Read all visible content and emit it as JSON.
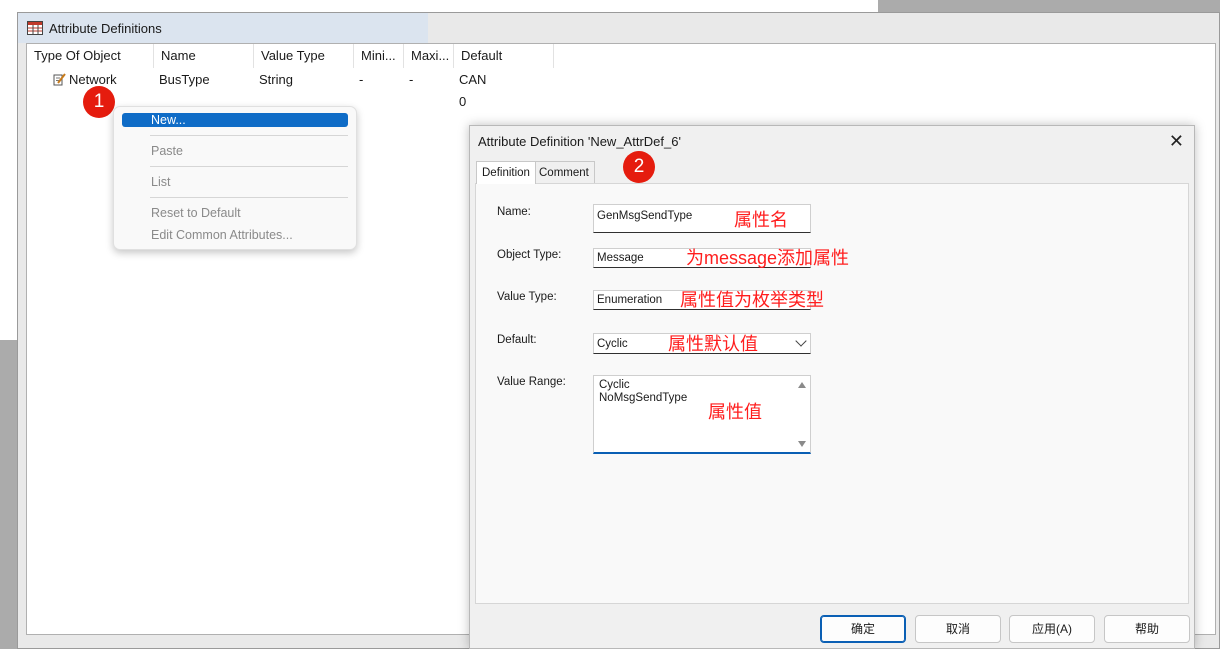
{
  "main_window": {
    "title": "Attribute Definitions",
    "columns": [
      "Type Of Object",
      "Name",
      "Value Type",
      "Mini...",
      "Maxi...",
      "Default"
    ],
    "rows": [
      {
        "type_of_object": "Network",
        "name": "BusType",
        "value_type": "String",
        "minimum": "-",
        "maximum": "-",
        "default": "CAN"
      },
      {
        "type_of_object": "",
        "name": "",
        "value_type": "",
        "minimum": "",
        "maximum": "",
        "default": "0"
      }
    ]
  },
  "badges": {
    "one": "1",
    "two": "2"
  },
  "context_menu": {
    "items": [
      {
        "label": "New...",
        "state": "highlighted"
      },
      {
        "label": "Paste",
        "state": "disabled"
      },
      {
        "label": "List",
        "state": "disabled"
      },
      {
        "label": "Reset to Default",
        "state": "disabled"
      },
      {
        "label": "Edit Common Attributes...",
        "state": "disabled"
      }
    ]
  },
  "dialog": {
    "title": "Attribute Definition 'New_AttrDef_6'",
    "tabs": [
      "Definition",
      "Comment"
    ],
    "selected_tab": "Definition",
    "labels": {
      "name": "Name:",
      "object_type": "Object Type:",
      "value_type": "Value Type:",
      "default": "Default:",
      "value_range": "Value Range:"
    },
    "values": {
      "name": "GenMsgSendType",
      "object_type": "Message",
      "value_type": "Enumeration",
      "default": "Cyclic",
      "value_range": [
        "Cyclic",
        "NoMsgSendType"
      ]
    },
    "annotations": {
      "name": "属性名",
      "object_type": "为message添加属性",
      "value_type": "属性值为枚举类型",
      "default": "属性默认值",
      "value_range": "属性值"
    },
    "buttons": {
      "ok": "确定",
      "cancel": "取消",
      "apply": "应用(A)",
      "help": "帮助"
    }
  },
  "colors": {
    "badge": "#e51c0e",
    "annotation": "#ff1e1e",
    "menu_highlight": "#0f6cc7",
    "title_bar": "#dbe4ef"
  }
}
